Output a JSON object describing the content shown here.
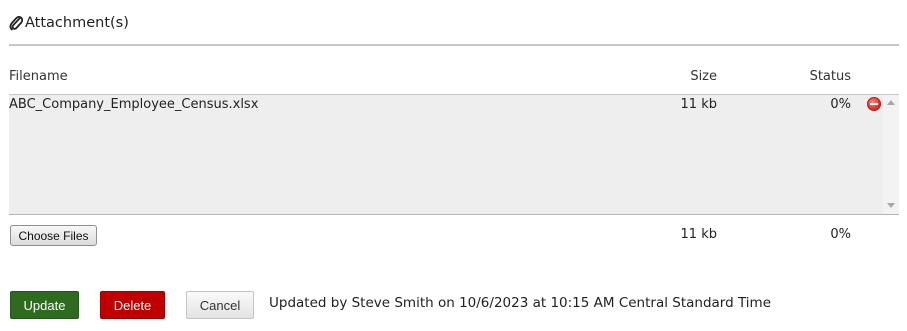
{
  "section": {
    "title": "Attachment(s)",
    "icon": "paperclip-icon"
  },
  "columns": {
    "filename": "Filename",
    "size": "Size",
    "status": "Status"
  },
  "files": [
    {
      "name": "ABC_Company_Employee_Census.xlsx",
      "size": "11 kb",
      "status": "0%"
    }
  ],
  "totals": {
    "size": "11 kb",
    "status": "0%"
  },
  "choose_files_label": "Choose Files",
  "actions": {
    "update": "Update",
    "delete": "Delete",
    "cancel": "Cancel"
  },
  "updated_by": "Updated by Steve Smith on 10/6/2023 at 10:15 AM Central Standard Time",
  "colors": {
    "update": "#2e6b1f",
    "delete": "#c00000",
    "remove_icon": "#e53935",
    "list_bg": "#eeeeee"
  }
}
